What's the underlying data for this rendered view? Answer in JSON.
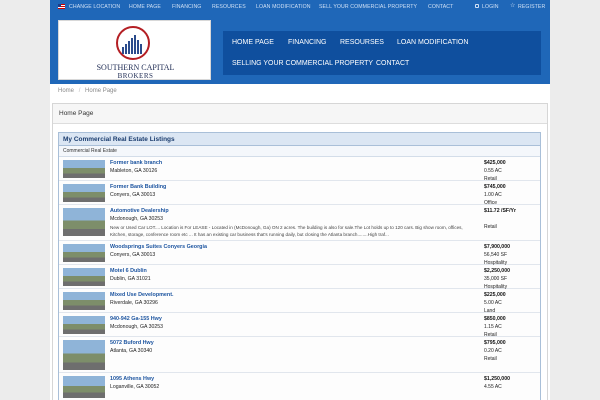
{
  "topbar": {
    "change_location": "CHANGE LOCATION",
    "home": "HOME PAGE",
    "financing": "FINANCING",
    "resources": "RESOURCES",
    "loan_mod": "LOAN MODIFICATION",
    "sell": "SELL YOUR COMMERCIAL PROPERTY",
    "contact": "CONTACT",
    "login": "LOGIN",
    "register": "REGISTER"
  },
  "logo": {
    "line1": "SOUTHERN CAPITAL",
    "line2": "BROKERS"
  },
  "nav": {
    "home": "HOME PAGE",
    "financing": "FINANCING",
    "resources": "RESOURSES",
    "loan_mod": "LOAN MODIFICATION",
    "sell": "SELLING YOUR COMMERCIAL PROPERTY",
    "contact": "CONTACT"
  },
  "breadcrumb": {
    "home": "Home",
    "sep": "/",
    "current": "Home Page"
  },
  "panel": {
    "title": "Home Page"
  },
  "listings": {
    "title": "My Commercial Real Estate Listings",
    "subtitle": "Commercial Real Estate",
    "rows": [
      {
        "title": "Former bank branch",
        "location": "Mableton, GA 30126",
        "desc": "",
        "price": "$425,000",
        "size": "0.55 AC",
        "type": "Retail"
      },
      {
        "title": "Former Bank Building",
        "location": "Conyers, GA 30013",
        "desc": "",
        "price": "$745,000",
        "size": "1.00 AC",
        "type": "Office"
      },
      {
        "title": "Automotive Dealership",
        "location": "Mcdonough, GA 30253",
        "desc": "New or Used Car LOT.... Location is For LEASE - Located in (McDonough, Ga) ON 2 acres. The building is also for sale.The Lot holds up to 120 cars. Big show room, offices, Kitchen, storage, conference room etc ... It has an existing car business that's running daily, but closing the Atlanta branch........High traf...",
        "price": "$11.72 /SF/Yr",
        "size": "",
        "type": "Retail"
      },
      {
        "title": "Woodsprings Suites Conyers Georgia",
        "location": "Conyers, GA 30013",
        "desc": "",
        "price": "$7,900,000",
        "size": "56,540 SF",
        "type": "Hospitality"
      },
      {
        "title": "Motel 6 Dublin",
        "location": "Dublin, GA 31021",
        "desc": "",
        "price": "$2,250,000",
        "size": "35,000 SF",
        "type": "Hospitality"
      },
      {
        "title": "Mixed Use Development.",
        "location": "Riverdale, GA 30296",
        "desc": "",
        "price": "$225,000",
        "size": "5.00 AC",
        "type": "Land"
      },
      {
        "title": "940-942 Ga-155 Hwy",
        "location": "Mcdonough, GA 30253",
        "desc": "",
        "price": "$850,000",
        "size": "1.15 AC",
        "type": "Retail"
      },
      {
        "title": "5072 Buford Hwy",
        "location": "Atlanta, GA 30340",
        "desc": "",
        "price": "$795,000",
        "size": "0.20 AC",
        "type": "Retail"
      },
      {
        "title": "1095 Athens Hwy",
        "location": "Loganville, GA 30052",
        "desc": "",
        "price": "$1,250,000",
        "size": "4.55 AC",
        "type": ""
      }
    ]
  }
}
